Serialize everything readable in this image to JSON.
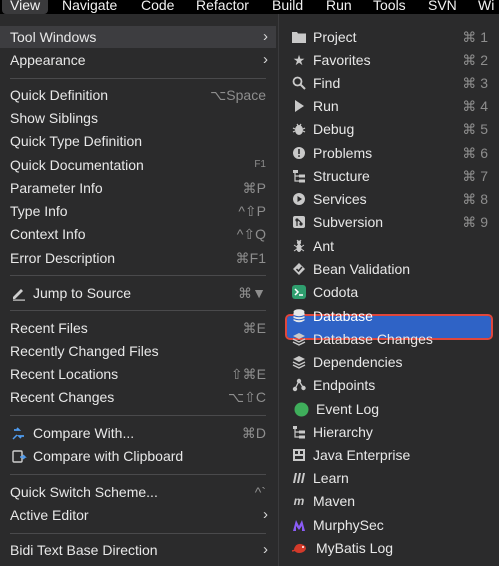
{
  "menubar": {
    "items": [
      "View",
      "Navigate",
      "Code",
      "Refactor",
      "Build",
      "Run",
      "Tools",
      "SVN",
      "Wi"
    ]
  },
  "menu": {
    "items": [
      {
        "label": "Tool Windows",
        "shortcut": "",
        "submenu": true
      },
      {
        "label": "Appearance",
        "shortcut": "",
        "submenu": true
      },
      {
        "label": "Quick Definition",
        "shortcut": "⌥Space"
      },
      {
        "label": "Show Siblings",
        "shortcut": ""
      },
      {
        "label": "Quick Type Definition",
        "shortcut": ""
      },
      {
        "label": "Quick Documentation",
        "shortcut": "F1"
      },
      {
        "label": "Parameter Info",
        "shortcut": "⌘P"
      },
      {
        "label": "Type Info",
        "shortcut": "^⇧P"
      },
      {
        "label": "Context Info",
        "shortcut": "^⇧Q"
      },
      {
        "label": "Error Description",
        "shortcut": "⌘F1"
      },
      {
        "label": "Jump to Source",
        "shortcut": "⌘▼",
        "icon": "pencil-icon"
      },
      {
        "label": "Recent Files",
        "shortcut": "⌘E"
      },
      {
        "label": "Recently Changed Files",
        "shortcut": ""
      },
      {
        "label": "Recent Locations",
        "shortcut": "⇧⌘E"
      },
      {
        "label": "Recent Changes",
        "shortcut": "⌥⇧C"
      },
      {
        "label": "Compare With...",
        "shortcut": "⌘D",
        "icon": "compare-icon"
      },
      {
        "label": "Compare with Clipboard",
        "shortcut": "",
        "icon": "clipboard-compare-icon"
      },
      {
        "label": "Quick Switch Scheme...",
        "shortcut": "^`"
      },
      {
        "label": "Active Editor",
        "shortcut": "",
        "submenu": true
      },
      {
        "label": "Bidi Text Base Direction",
        "shortcut": "",
        "submenu": true
      }
    ]
  },
  "submenu": {
    "items": [
      {
        "label": "Project",
        "shortcut": "⌘ 1",
        "icon": "folder-icon"
      },
      {
        "label": "Favorites",
        "shortcut": "⌘ 2",
        "icon": "star-icon"
      },
      {
        "label": "Find",
        "shortcut": "⌘ 3",
        "icon": "search-icon"
      },
      {
        "label": "Run",
        "shortcut": "⌘ 4",
        "icon": "play-icon"
      },
      {
        "label": "Debug",
        "shortcut": "⌘ 5",
        "icon": "bug-icon"
      },
      {
        "label": "Problems",
        "shortcut": "⌘ 6",
        "icon": "problems-icon"
      },
      {
        "label": "Structure",
        "shortcut": "⌘ 7",
        "icon": "structure-icon"
      },
      {
        "label": "Services",
        "shortcut": "⌘ 8",
        "icon": "services-icon"
      },
      {
        "label": "Subversion",
        "shortcut": "⌘ 9",
        "icon": "subversion-icon"
      },
      {
        "label": "Ant",
        "shortcut": "",
        "icon": "ant-icon"
      },
      {
        "label": "Bean Validation",
        "shortcut": "",
        "icon": "bean-validation-icon"
      },
      {
        "label": "Codota",
        "shortcut": "",
        "icon": "codota-icon"
      },
      {
        "label": "Database",
        "shortcut": "",
        "icon": "database-icon",
        "selected": true
      },
      {
        "label": "Database Changes",
        "shortcut": "",
        "icon": "database-changes-icon"
      },
      {
        "label": "Dependencies",
        "shortcut": "",
        "icon": "dependencies-icon"
      },
      {
        "label": "Endpoints",
        "shortcut": "",
        "icon": "endpoints-icon"
      },
      {
        "label": "Event Log",
        "shortcut": "",
        "icon": "event-log-icon"
      },
      {
        "label": "Hierarchy",
        "shortcut": "",
        "icon": "hierarchy-icon"
      },
      {
        "label": "Java Enterprise",
        "shortcut": "",
        "icon": "java-enterprise-icon"
      },
      {
        "label": "Learn",
        "shortcut": "",
        "icon": "learn-icon"
      },
      {
        "label": "Maven",
        "shortcut": "",
        "icon": "maven-icon"
      },
      {
        "label": "MurphySec",
        "shortcut": "",
        "icon": "murphysec-icon"
      },
      {
        "label": "MyBatis Log",
        "shortcut": "",
        "icon": "mybatis-log-icon"
      }
    ]
  },
  "colors": {
    "selection": "#2f63c6",
    "highlight_border": "#e0473c",
    "codota": "#2f9e6e",
    "event_log": "#3fae5b",
    "murphysec": "#8a5cf6",
    "mybatis": "#d33a2a"
  }
}
